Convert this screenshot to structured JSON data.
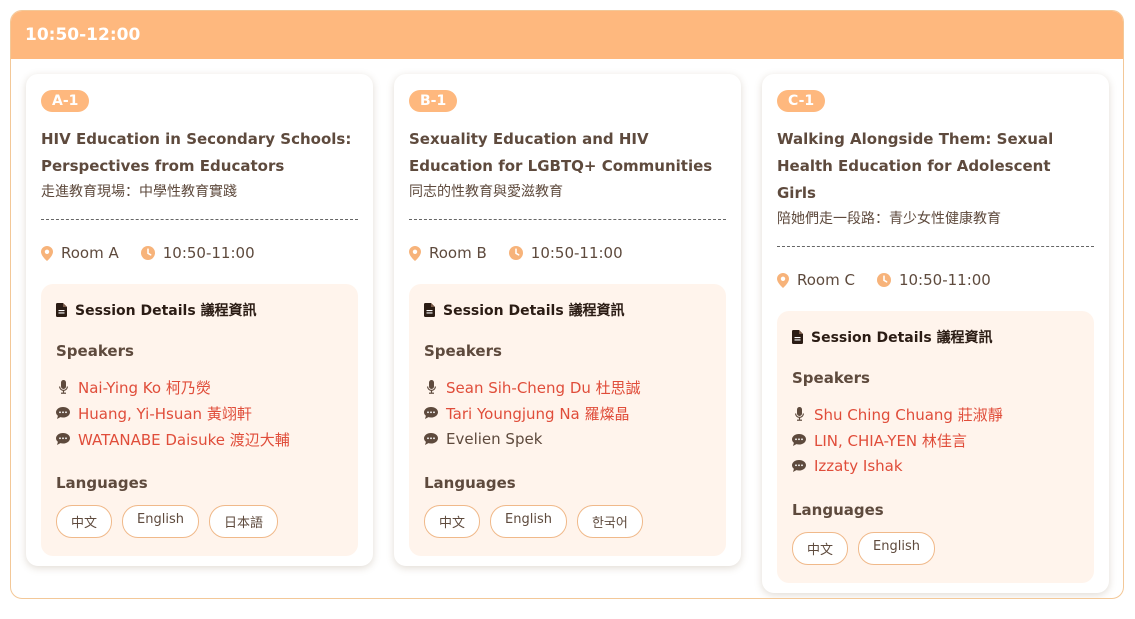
{
  "header": {
    "time_slot": "10:50-12:00"
  },
  "sessions": [
    {
      "code": "A-1",
      "title_en": "HIV Education in Secondary Schools: Perspectives from Educators",
      "title_zh": "走進教育現場：中學性教育實踐",
      "room": "Room A",
      "time": "10:50-11:00",
      "details_label": "Session Details 議程資訊",
      "speakers_label": "Speakers",
      "speakers": [
        {
          "icon": "microphone-icon",
          "name": "Nai-Ying Ko 柯乃熒",
          "linked": true
        },
        {
          "icon": "chat-icon",
          "name": "Huang, Yi-Hsuan 黃翊軒",
          "linked": true
        },
        {
          "icon": "chat-icon",
          "name": "WATANABE Daisuke 渡辺大輔",
          "linked": true
        }
      ],
      "languages_label": "Languages",
      "languages": [
        "中文",
        "English",
        "日本語"
      ]
    },
    {
      "code": "B-1",
      "title_en": "Sexuality Education and HIV Education for LGBTQ+ Communities",
      "title_zh": "同志的性教育與愛滋教育",
      "room": "Room B",
      "time": "10:50-11:00",
      "details_label": "Session Details 議程資訊",
      "speakers_label": "Speakers",
      "speakers": [
        {
          "icon": "microphone-icon",
          "name": "Sean Sih-Cheng Du 杜思誠",
          "linked": true
        },
        {
          "icon": "chat-icon",
          "name": "Tari Youngjung Na 羅燦晶",
          "linked": true
        },
        {
          "icon": "chat-icon",
          "name": "Evelien Spek",
          "linked": false
        }
      ],
      "languages_label": "Languages",
      "languages": [
        "中文",
        "English",
        "한국어"
      ]
    },
    {
      "code": "C-1",
      "title_en": "Walking Alongside Them: Sexual Health Education for Adolescent Girls",
      "title_zh": "陪她們走一段路：青少女性健康教育",
      "room": "Room C",
      "time": "10:50-11:00",
      "details_label": "Session Details 議程資訊",
      "speakers_label": "Speakers",
      "speakers": [
        {
          "icon": "microphone-icon",
          "name": "Shu Ching Chuang 莊淑靜",
          "linked": true
        },
        {
          "icon": "chat-icon",
          "name": "LIN, CHIA-YEN 林佳言",
          "linked": true
        },
        {
          "icon": "chat-icon",
          "name": "Izzaty Ishak",
          "linked": true
        }
      ],
      "languages_label": "Languages",
      "languages": [
        "中文",
        "English"
      ]
    }
  ],
  "colors": {
    "accent": "#feb87e",
    "link": "#e04d3a",
    "panel": "#fff4ec",
    "border": "#f3c898"
  }
}
